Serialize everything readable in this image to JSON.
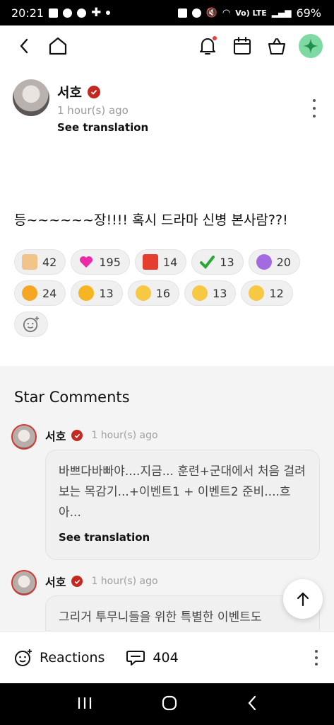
{
  "status_bar": {
    "time": "20:21",
    "battery": "69%",
    "network": "Vo) LTE"
  },
  "post": {
    "author": "서호",
    "time": "1 hour(s) ago",
    "see_translation": "See translation",
    "body": "등~~~~~~장!!!! 혹시 드라마 신병 본사람??!"
  },
  "reactions": [
    {
      "icon": "thumbs-up-icon",
      "count": "42",
      "color": "#f2c38a"
    },
    {
      "icon": "heart-icon",
      "count": "195",
      "color": "#ec2aa8"
    },
    {
      "icon": "popcorn-icon",
      "count": "14",
      "color": "#e53d2f"
    },
    {
      "icon": "checkmark-icon",
      "count": "13",
      "color": "#2aa836"
    },
    {
      "icon": "flower-icon",
      "count": "20",
      "color": "#a46be0"
    },
    {
      "icon": "laughing-face-icon",
      "count": "24",
      "color": "#f6a623"
    },
    {
      "icon": "crying-face-icon",
      "count": "13",
      "color": "#f6b623"
    },
    {
      "icon": "heart-eyes-icon",
      "count": "16",
      "color": "#f7c843"
    },
    {
      "icon": "surprised-face-icon",
      "count": "13",
      "color": "#f7c843"
    },
    {
      "icon": "sunglasses-face-icon",
      "count": "12",
      "color": "#f7c843"
    }
  ],
  "star_comments": {
    "title": "Star Comments",
    "items": [
      {
        "author": "서호",
        "time": "1 hour(s) ago",
        "text": "바쁘다바빠야....지금... 훈련+군대에서 처음 걸려보는 목감기...+이벤트1 + 이벤트2 준비....흐아...",
        "see_translation": "See translation"
      },
      {
        "author": "서호",
        "time": "1 hour(s) ago",
        "text": "그리거 투무니들을 위한 특별한 이벤트도"
      }
    ]
  },
  "bottom_bar": {
    "reactions_label": "Reactions",
    "comments_count": "404"
  },
  "colors": {
    "verified": "#c6281f",
    "accent": "#7ed9a3"
  }
}
